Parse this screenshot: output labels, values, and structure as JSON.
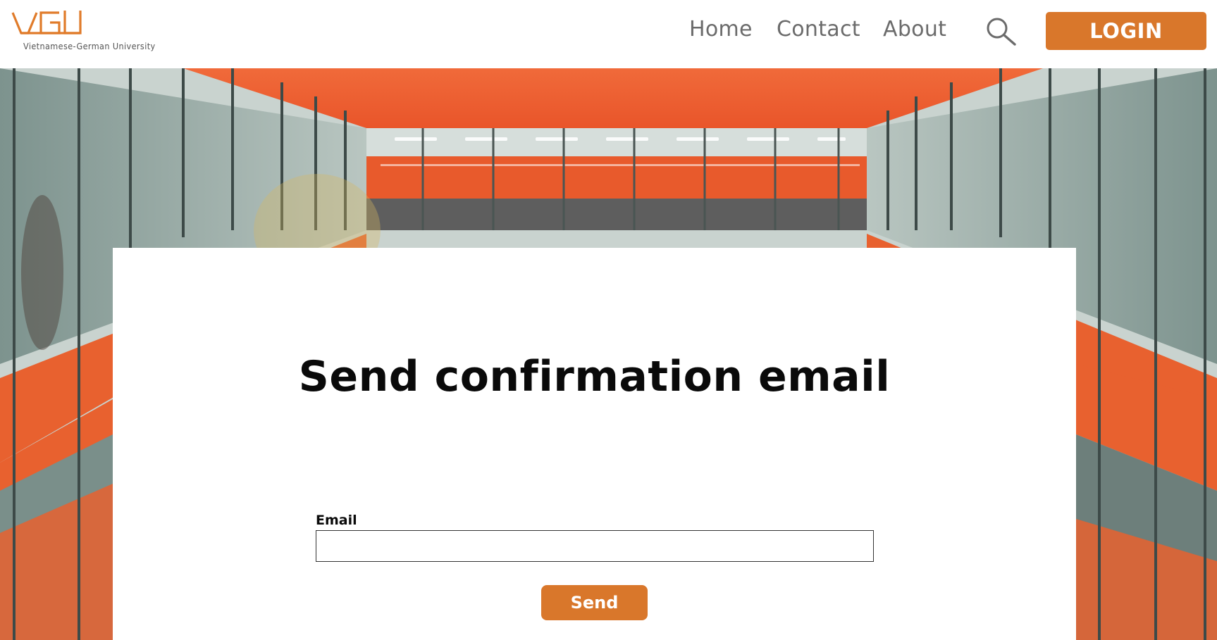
{
  "header": {
    "logo_text": "VGU",
    "logo_caption": "Vietnamese-German University",
    "nav": {
      "home": "Home",
      "contact": "Contact",
      "about": "About"
    },
    "search_icon": "search-icon",
    "login_label": "LOGIN"
  },
  "form": {
    "title": "Send confirmation email",
    "email_label": "Email",
    "email_value": "",
    "email_placeholder": "",
    "send_label": "Send"
  },
  "colors": {
    "accent": "#d9772b",
    "logo_orange": "#e07b2a",
    "hero_orange": "#e8612f"
  }
}
